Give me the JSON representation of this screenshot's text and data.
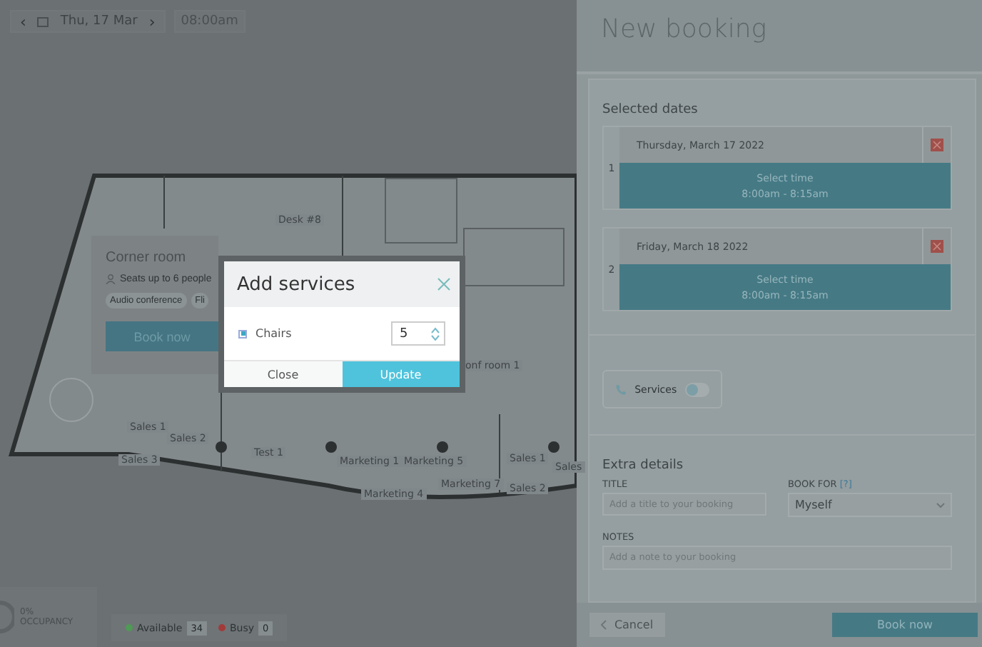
{
  "toolbar": {
    "prev": "‹",
    "date": "Thu, 17 Mar",
    "next": "›",
    "time": "08:00am"
  },
  "floor_plan": {
    "labels": [
      "Desk #8",
      "onf room 1",
      "Sales 1",
      "Sales 2",
      "Sales 3",
      "Test 1",
      "Marketing 1",
      "Marketing 5",
      "Marketing 7",
      "Marketing 4",
      "Sales 1",
      "Sales 2",
      "Sales"
    ]
  },
  "room_card": {
    "title": "Corner room",
    "seats": "Seats up to 6 people",
    "tags": [
      "Audio conference",
      "Fli"
    ],
    "button": "Book now"
  },
  "occupancy": {
    "value": "0%",
    "label": "OCCUPANCY"
  },
  "legend": [
    {
      "label": "Available",
      "count": "34",
      "color": "#4f9a55"
    },
    {
      "label": "Busy",
      "count": "0",
      "color": "#a33a3a"
    }
  ],
  "modal": {
    "title": "Add services",
    "services": [
      {
        "name": "Chairs",
        "checked": true,
        "quantity": "5"
      }
    ],
    "buttons": [
      {
        "label": "Close",
        "kind": "secondary"
      },
      {
        "label": "Update",
        "kind": "primary"
      }
    ]
  },
  "booking": {
    "title": "New booking",
    "dates_heading": "Selected dates",
    "dates": [
      {
        "index": "1",
        "date": "Thursday, March 17 2022",
        "action": "Select time",
        "time": "8:00am - 8:15am"
      },
      {
        "index": "2",
        "date": "Friday, March 18 2022",
        "action": "Select time",
        "time": "8:00am - 8:15am"
      }
    ],
    "services": {
      "label": "Services",
      "on": false
    },
    "extra_heading": "Extra details",
    "title_field": {
      "label": "TITLE",
      "placeholder": "Add a title to your booking"
    },
    "book_for": {
      "label": "BOOK FOR",
      "help": "[?]",
      "value": "Myself"
    },
    "notes": {
      "label": "NOTES",
      "placeholder": "Add a note to your booking"
    },
    "cancel": "Cancel",
    "submit": "Book now"
  }
}
